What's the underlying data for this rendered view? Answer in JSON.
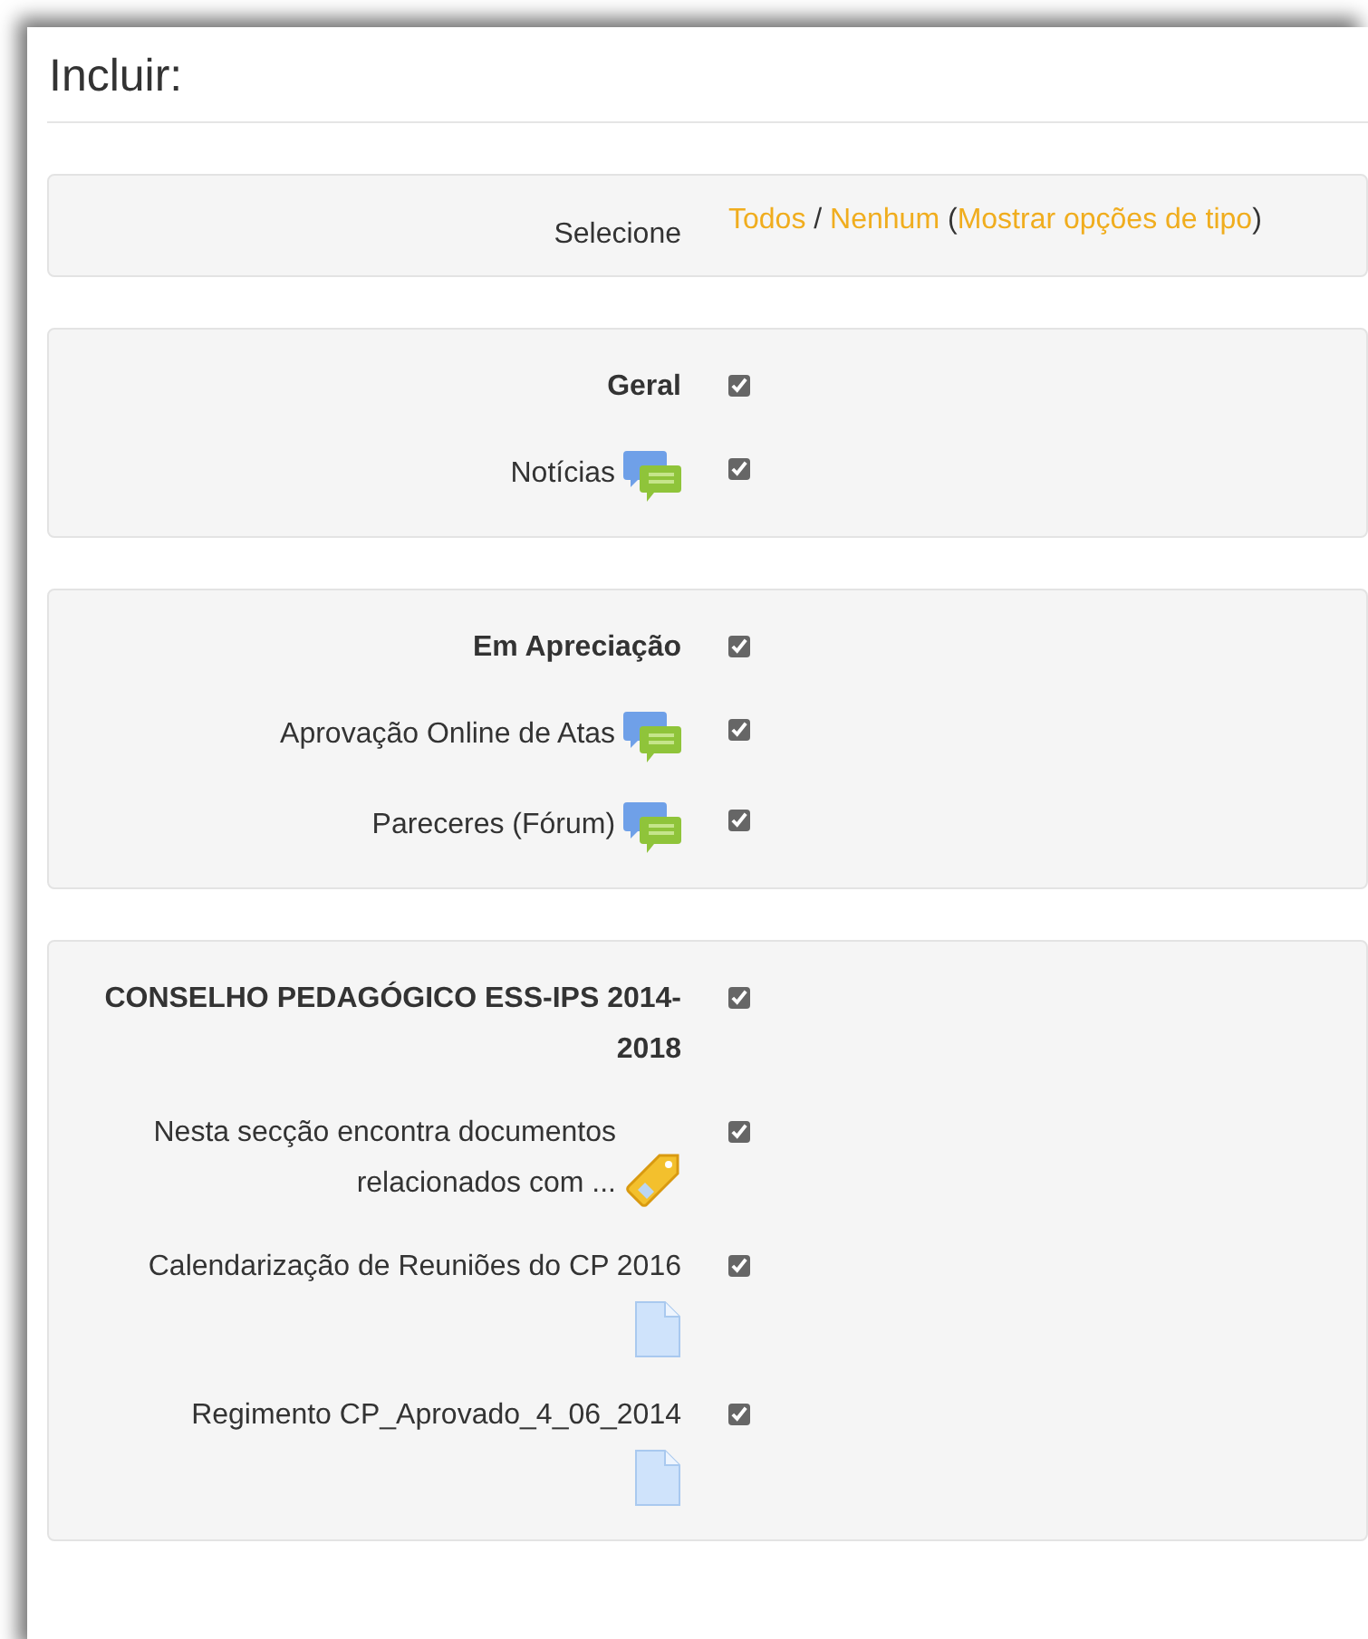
{
  "title": "Incluir:",
  "select_row": {
    "label": "Selecione",
    "parts": [
      {
        "kind": "link",
        "text": "Todos"
      },
      {
        "kind": "text",
        "text": " / "
      },
      {
        "kind": "link",
        "text": "Nenhum"
      },
      {
        "kind": "text",
        "text": " ("
      },
      {
        "kind": "link",
        "text": "Mostrar opções de tipo"
      },
      {
        "kind": "text",
        "text": ")"
      }
    ]
  },
  "sections": [
    {
      "items": [
        {
          "kind": "section",
          "label": "Geral",
          "checked": true
        },
        {
          "kind": "forum",
          "label": "Notícias",
          "checked": true
        }
      ]
    },
    {
      "items": [
        {
          "kind": "section",
          "label": "Em Apreciação",
          "checked": true
        },
        {
          "kind": "forum",
          "label": "Aprovação Online de Atas",
          "checked": true
        },
        {
          "kind": "forum",
          "label": "Pareceres (Fórum)",
          "checked": true
        }
      ]
    },
    {
      "items": [
        {
          "kind": "section",
          "label": "CONSELHO PEDAGÓGICO ESS-IPS 2014-2018",
          "checked": true
        },
        {
          "kind": "label",
          "label": "Nesta secção encontra documentos relacionados com ...",
          "checked": true
        },
        {
          "kind": "file",
          "label": "Calendarização de Reuniões do CP 2016",
          "checked": true
        },
        {
          "kind": "file",
          "label": "Regimento CP_Aprovado_4_06_2014",
          "checked": true
        }
      ]
    }
  ]
}
